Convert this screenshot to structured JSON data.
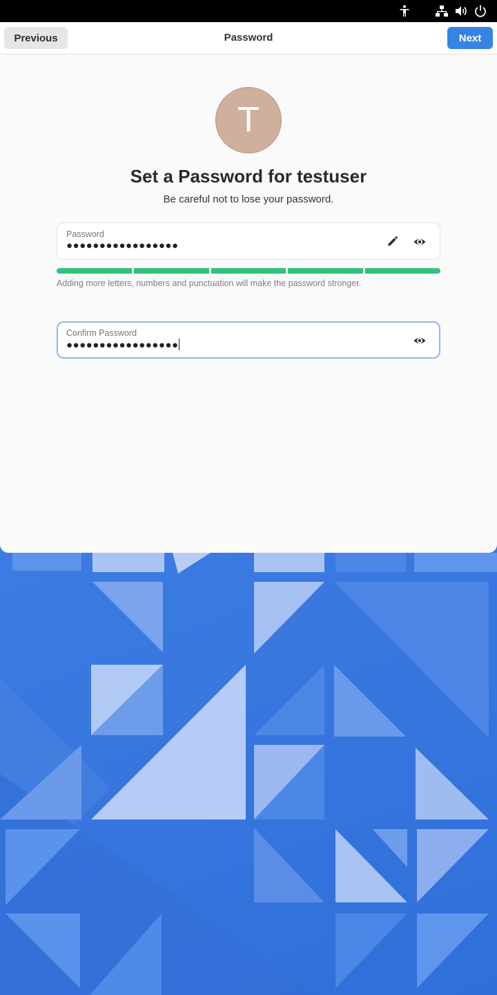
{
  "header": {
    "previous_label": "Previous",
    "title": "Password",
    "next_label": "Next"
  },
  "avatar": {
    "initial": "T",
    "color": "#cfb09c"
  },
  "page": {
    "title": "Set a Password for testuser",
    "subtitle": "Be careful not to lose your password."
  },
  "password_field": {
    "label": "Password",
    "value": "●●●●●●●●●●●●●●●●●"
  },
  "strength": {
    "segments_filled": 5,
    "segments_total": 5,
    "color": "#33c17d",
    "hint": "Adding more letters, numbers and punctuation will make the password stronger."
  },
  "confirm_field": {
    "label": "Confirm Password",
    "value": "●●●●●●●●●●●●●●●●●"
  },
  "system_tray": {
    "icons": [
      "accessibility-icon",
      "network-icon",
      "volume-icon",
      "power-icon"
    ]
  },
  "accent_color": "#3584e4"
}
